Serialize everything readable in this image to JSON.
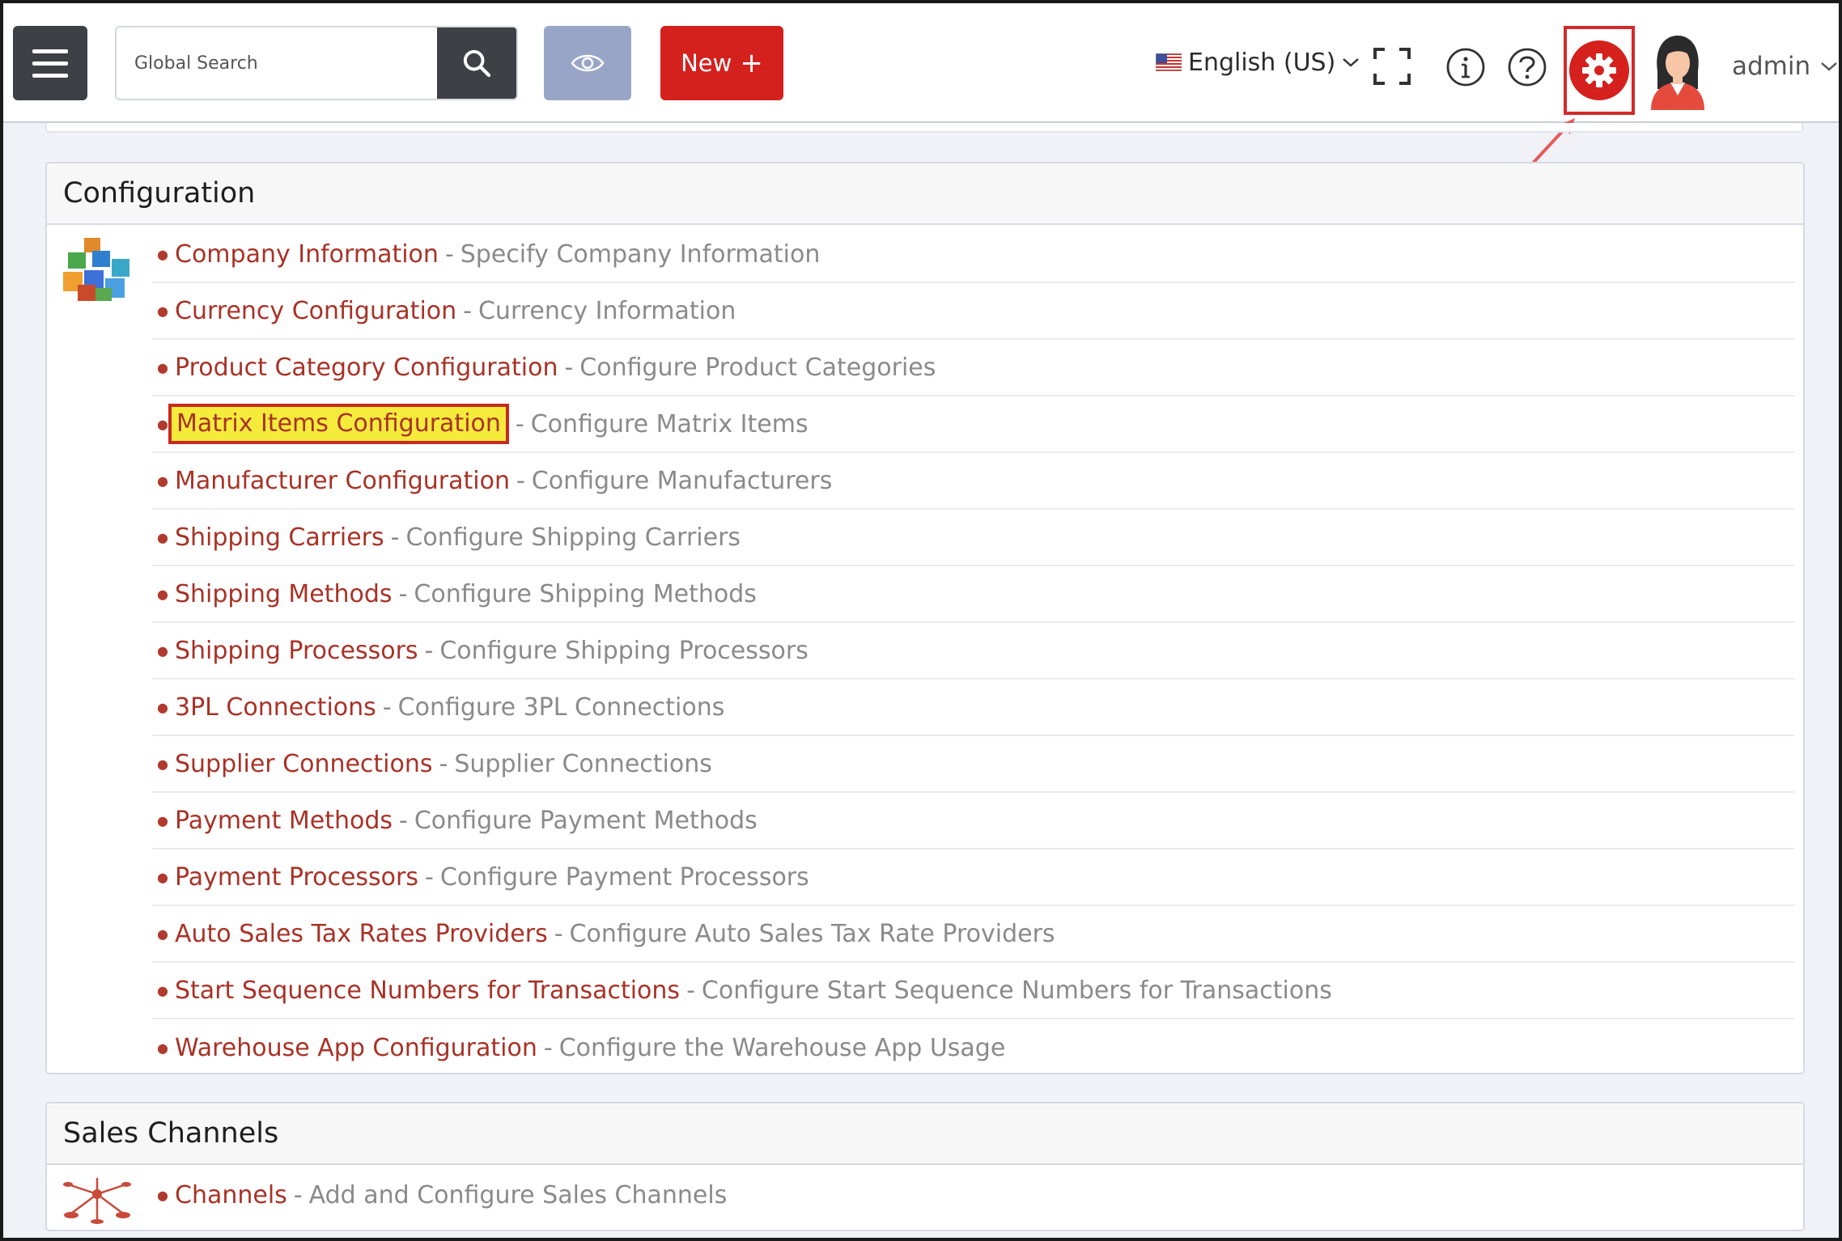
{
  "header": {
    "search_placeholder": "Global Search",
    "new_button_label": "New",
    "new_button_plus": "+",
    "language_label": "English (US)",
    "user_name": "admin"
  },
  "colors": {
    "accent_red": "#d5211e",
    "dark_button": "#3d4044",
    "eye_button": "#99a5c7",
    "link_red": "#a83227",
    "highlight_yellow": "#f5eb3a"
  },
  "icons": {
    "menu": "hamburger-menu-icon",
    "search": "search-icon",
    "preview": "eye-icon",
    "language": "us-flag-icon",
    "fullscreen": "fullscreen-icon",
    "info": "info-icon",
    "help": "help-icon",
    "settings": "gear-icon",
    "user": "user-avatar-icon"
  },
  "configuration": {
    "title": "Configuration",
    "items": [
      {
        "label": "Company Information",
        "description": "Specify Company Information"
      },
      {
        "label": "Currency Configuration",
        "description": "Currency Information"
      },
      {
        "label": "Product Category Configuration",
        "description": "Configure Product Categories"
      },
      {
        "label": "Matrix Items Configuration",
        "description": "Configure Matrix Items"
      },
      {
        "label": "Manufacturer Configuration",
        "description": "Configure Manufacturers"
      },
      {
        "label": "Shipping Carriers",
        "description": "Configure Shipping Carriers"
      },
      {
        "label": "Shipping Methods",
        "description": "Configure Shipping Methods"
      },
      {
        "label": "Shipping Processors",
        "description": "Configure Shipping Processors"
      },
      {
        "label": "3PL Connections",
        "description": "Configure 3PL Connections"
      },
      {
        "label": "Supplier Connections",
        "description": "Supplier Connections"
      },
      {
        "label": "Payment Methods",
        "description": "Configure Payment Methods"
      },
      {
        "label": "Payment Processors",
        "description": "Configure Payment Processors"
      },
      {
        "label": "Auto Sales Tax Rates Providers",
        "description": "Configure Auto Sales Tax Rate Providers"
      },
      {
        "label": "Start Sequence Numbers for Transactions",
        "description": "Configure Start Sequence Numbers for Transactions"
      },
      {
        "label": "Warehouse App Configuration",
        "description": "Configure the Warehouse App Usage"
      }
    ],
    "separator": "-"
  },
  "sales_channels": {
    "title": "Sales Channels",
    "items": [
      {
        "label": "Channels",
        "description": "Add and Configure Sales Channels"
      }
    ]
  }
}
